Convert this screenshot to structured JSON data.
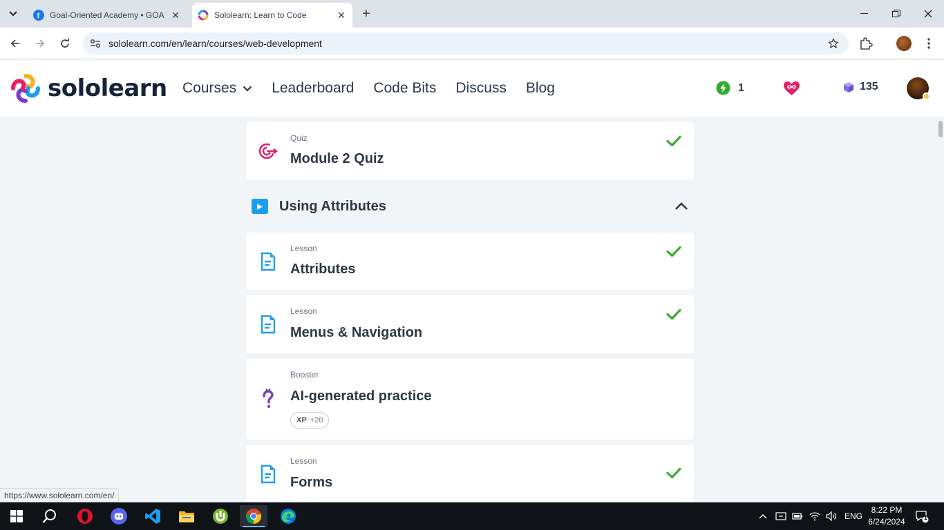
{
  "browser": {
    "tabs": [
      {
        "title": "Goal-Oriented Academy • GOA",
        "active": false
      },
      {
        "title": "Sololearn: Learn to Code",
        "active": true
      }
    ],
    "url": "sololearn.com/en/learn/courses/web-development",
    "status_url": "https://www.sololearn.com/en/"
  },
  "site": {
    "logo_text": "sololearn",
    "nav": [
      "Courses",
      "Leaderboard",
      "Code Bits",
      "Discuss",
      "Blog"
    ],
    "streak": "1",
    "gems": "135",
    "colors": {
      "accent": "#1b9ef0",
      "check": "#3aa932",
      "heart": "#e4206b",
      "quiz": "#e4206b",
      "booster": "#7b3fc4"
    }
  },
  "content": {
    "quiz_card": {
      "kind": "Quiz",
      "title": "Module 2 Quiz",
      "completed": true
    },
    "module": {
      "title": "Using Attributes",
      "expanded": true
    },
    "items": [
      {
        "kind": "Lesson",
        "title": "Attributes",
        "completed": true,
        "icon": "lesson-icon"
      },
      {
        "kind": "Lesson",
        "title": "Menus & Navigation",
        "completed": true,
        "icon": "lesson-icon"
      },
      {
        "kind": "Booster",
        "title": "AI-generated practice",
        "completed": false,
        "icon": "question-mark-icon",
        "xp_label": "XP",
        "xp_value": "+20"
      },
      {
        "kind": "Lesson",
        "title": "Forms",
        "completed": true,
        "icon": "lesson-icon"
      }
    ]
  },
  "taskbar": {
    "tray_lang": "ENG",
    "time": "8:22 PM",
    "date": "6/24/2024",
    "notifications": "1"
  }
}
